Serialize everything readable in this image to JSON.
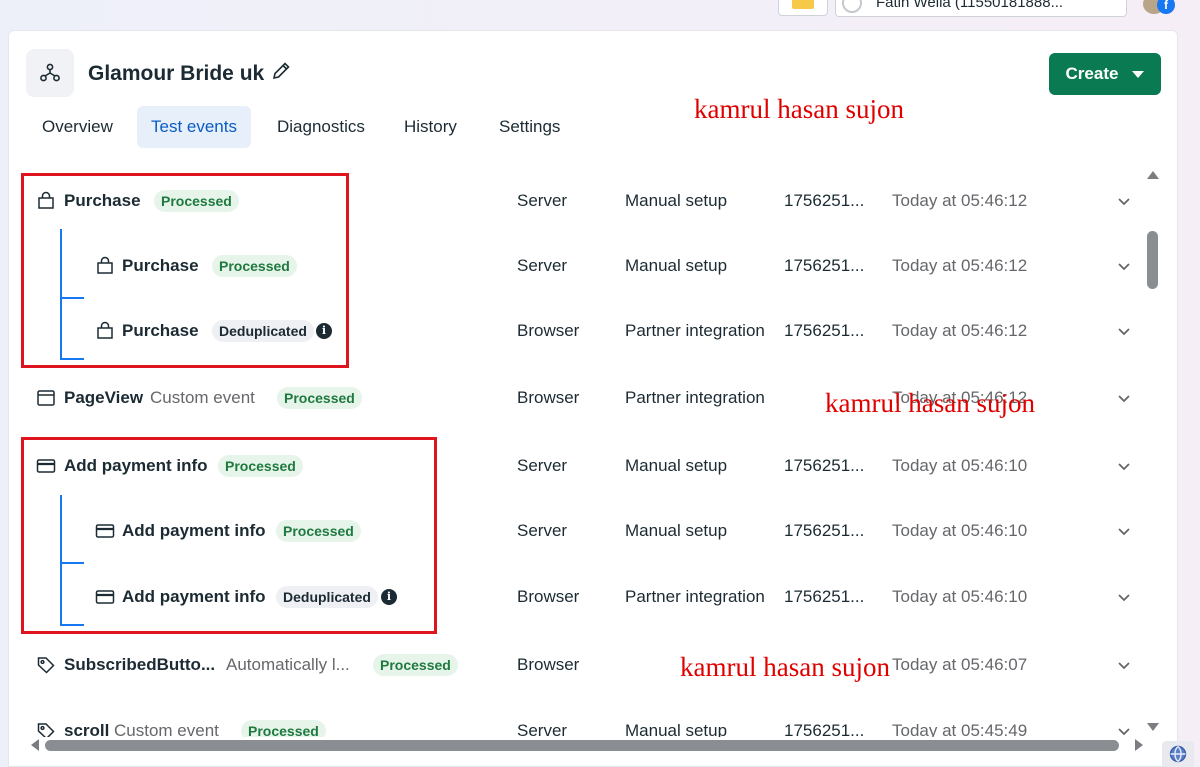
{
  "browser": {
    "account_text": "Fatih Wella (11550181888..."
  },
  "header": {
    "dataset_name": "Glamour Bride uk",
    "create_label": "Create"
  },
  "tabs": [
    {
      "label": "Overview",
      "active": false
    },
    {
      "label": "Test events",
      "active": true
    },
    {
      "label": "Diagnostics",
      "active": false
    },
    {
      "label": "History",
      "active": false
    },
    {
      "label": "Settings",
      "active": false
    }
  ],
  "watermarks": [
    "kamrul hasan sujon",
    "kamrul hasan sujon",
    "kamrul hasan sujon"
  ],
  "events": [
    {
      "name": "Purchase",
      "sub": "",
      "status": "Processed",
      "source": "Server",
      "setup": "Manual setup",
      "id": "1756251...",
      "time": "Today at 05:46:12",
      "icon": "shopping-bag-icon"
    },
    {
      "name": "Purchase",
      "sub": "",
      "status": "Processed",
      "source": "Server",
      "setup": "Manual setup",
      "id": "1756251...",
      "time": "Today at 05:46:12",
      "icon": "shopping-bag-icon"
    },
    {
      "name": "Purchase",
      "sub": "",
      "status": "Deduplicated",
      "source": "Browser",
      "setup": "Partner integration",
      "id": "1756251...",
      "time": "Today at 05:46:12",
      "icon": "shopping-bag-icon"
    },
    {
      "name": "PageView",
      "sub": "Custom event",
      "status": "Processed",
      "source": "Browser",
      "setup": "Partner integration",
      "id": "",
      "time": "Today at 05:46:12",
      "icon": "browser-window-icon"
    },
    {
      "name": "Add payment info",
      "sub": "",
      "status": "Processed",
      "source": "Server",
      "setup": "Manual setup",
      "id": "1756251...",
      "time": "Today at 05:46:10",
      "icon": "credit-card-icon"
    },
    {
      "name": "Add payment info",
      "sub": "",
      "status": "Processed",
      "source": "Server",
      "setup": "Manual setup",
      "id": "1756251...",
      "time": "Today at 05:46:10",
      "icon": "credit-card-icon"
    },
    {
      "name": "Add payment info",
      "sub": "",
      "status": "Deduplicated",
      "source": "Browser",
      "setup": "Partner integration",
      "id": "1756251...",
      "time": "Today at 05:46:10",
      "icon": "credit-card-icon"
    },
    {
      "name": "SubscribedButto...",
      "sub": "Automatically l...",
      "status": "Processed",
      "source": "Browser",
      "setup": "",
      "id": "",
      "time": "Today at 05:46:07",
      "icon": "tag-icon"
    },
    {
      "name": "scroll",
      "sub": "Custom event",
      "status": "Processed",
      "source": "Server",
      "setup": "Manual setup",
      "id": "1756251...",
      "time": "Today at 05:45:49",
      "icon": "tag-icon"
    }
  ]
}
